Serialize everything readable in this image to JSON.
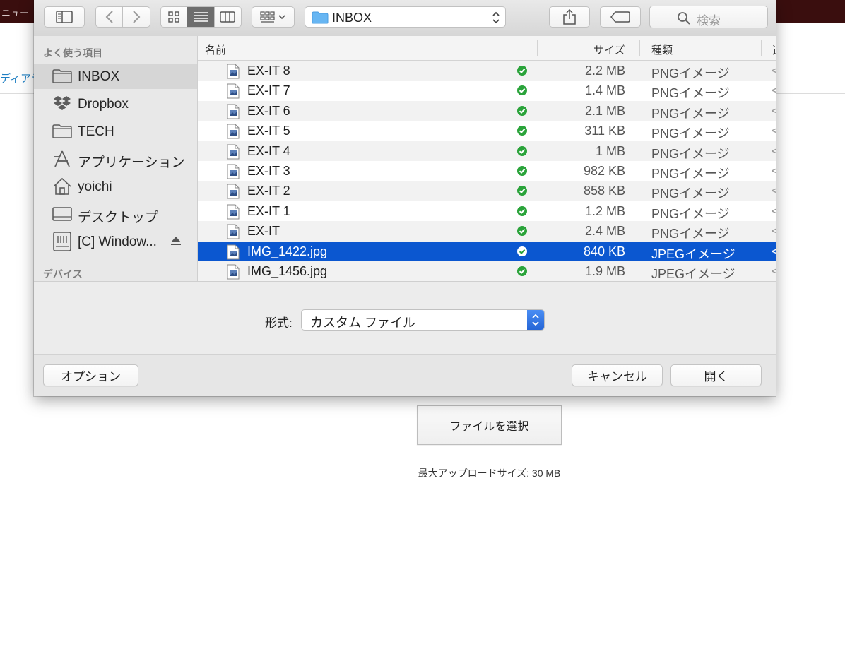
{
  "background": {
    "menu_text": "ニュー",
    "nav_link": "ディアラ",
    "choose_file_label": "ファイルを選択",
    "max_upload_text": "最大アップロードサイズ: 30 MB"
  },
  "toolbar": {
    "location": "INBOX",
    "search_placeholder": "検索",
    "icons": [
      "sidebar-toggle-icon",
      "back-icon",
      "forward-icon",
      "icon-view-icon",
      "list-view-icon",
      "column-view-icon",
      "arrange-icon",
      "share-icon",
      "tag-icon",
      "search-icon"
    ]
  },
  "sidebar": {
    "favorites_header": "よく使う項目",
    "items": [
      {
        "label": "INBOX",
        "icon": "folder-icon",
        "selected": true
      },
      {
        "label": "Dropbox",
        "icon": "dropbox-icon",
        "selected": false
      },
      {
        "label": "TECH",
        "icon": "folder-icon",
        "selected": false
      },
      {
        "label": "アプリケーション",
        "icon": "applications-icon",
        "selected": false
      },
      {
        "label": "yoichi",
        "icon": "home-icon",
        "selected": false
      },
      {
        "label": "デスクトップ",
        "icon": "desktop-icon",
        "selected": false
      },
      {
        "label": "[C] Window...",
        "icon": "disk-icon",
        "selected": false
      }
    ],
    "devices_header": "デバイス"
  },
  "columns": {
    "name": "名前",
    "size": "サイズ",
    "kind": "種類",
    "extra": "追"
  },
  "files": [
    {
      "name": "EX-IT 8",
      "size": "2.2 MB",
      "kind": "PNGイメージ",
      "extra": "<"
    },
    {
      "name": "EX-IT 7",
      "size": "1.4 MB",
      "kind": "PNGイメージ",
      "extra": "<"
    },
    {
      "name": "EX-IT 6",
      "size": "2.1 MB",
      "kind": "PNGイメージ",
      "extra": "<"
    },
    {
      "name": "EX-IT 5",
      "size": "311 KB",
      "kind": "PNGイメージ",
      "extra": "<"
    },
    {
      "name": "EX-IT 4",
      "size": "1 MB",
      "kind": "PNGイメージ",
      "extra": "<"
    },
    {
      "name": "EX-IT 3",
      "size": "982 KB",
      "kind": "PNGイメージ",
      "extra": "<"
    },
    {
      "name": "EX-IT 2",
      "size": "858 KB",
      "kind": "PNGイメージ",
      "extra": "<"
    },
    {
      "name": "EX-IT 1",
      "size": "1.2 MB",
      "kind": "PNGイメージ",
      "extra": "<"
    },
    {
      "name": "EX-IT",
      "size": "2.4 MB",
      "kind": "PNGイメージ",
      "extra": "<"
    },
    {
      "name": "IMG_1422.jpg",
      "size": "840 KB",
      "kind": "JPEGイメージ",
      "extra": "<",
      "selected": true
    },
    {
      "name": "IMG_1456.jpg",
      "size": "1.9 MB",
      "kind": "JPEGイメージ",
      "extra": "<"
    }
  ],
  "format": {
    "label": "形式:",
    "value": "カスタム ファイル"
  },
  "buttons": {
    "options": "オプション",
    "cancel": "キャンセル",
    "open": "開く"
  },
  "colors": {
    "selection": "#0b57d0",
    "sync_check": "#2aa33a",
    "accent_select": "#2566d6"
  }
}
